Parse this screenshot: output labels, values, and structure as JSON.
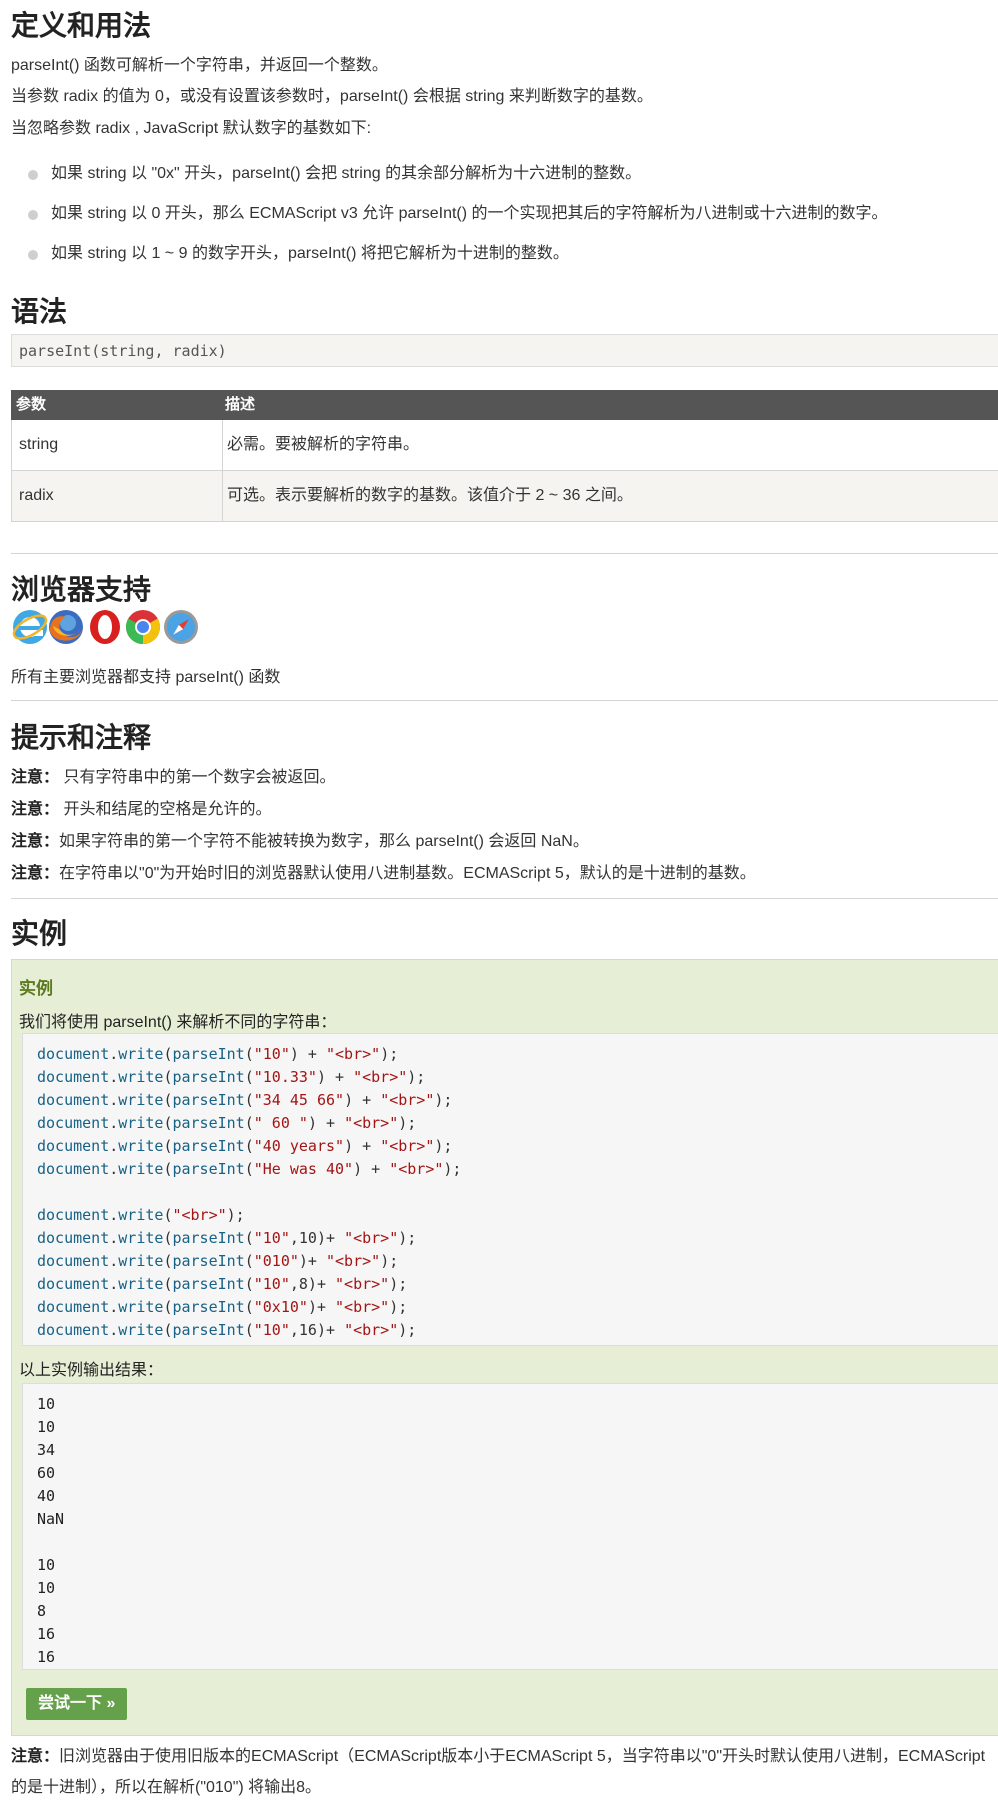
{
  "definition": {
    "heading": "定义和用法",
    "paragraphs": [
      "parseInt() 函数可解析一个字符串，并返回一个整数。",
      "当参数 radix 的值为 0，或没有设置该参数时，parseInt() 会根据 string 来判断数字的基数。",
      "当忽略参数 radix , JavaScript 默认数字的基数如下:"
    ],
    "bullets": [
      "如果 string 以 \"0x\" 开头，parseInt() 会把 string 的其余部分解析为十六进制的整数。",
      "如果 string 以 0 开头，那么 ECMAScript v3 允许 parseInt() 的一个实现把其后的字符解析为八进制或十六进制的数字。",
      "如果 string 以 1 ~ 9 的数字开头，parseInt() 将把它解析为十进制的整数。"
    ]
  },
  "syntax": {
    "heading": "语法",
    "code": "parseInt(string, radix)"
  },
  "params_table": {
    "headers": [
      "参数",
      "描述"
    ],
    "rows": [
      [
        "string",
        "必需。要被解析的字符串。"
      ],
      [
        "radix",
        "可选。表示要解析的数字的基数。该值介于 2 ~ 36 之间。"
      ]
    ]
  },
  "browser_support": {
    "heading": "浏览器支持",
    "icons": [
      "ie-icon",
      "firefox-icon",
      "opera-icon",
      "chrome-icon",
      "safari-icon"
    ],
    "text": "所有主要浏览器都支持 parseInt() 函数"
  },
  "tips": {
    "heading": "提示和注释",
    "notes": [
      {
        "label": "注意：",
        "text": " 只有字符串中的第一个数字会被返回。"
      },
      {
        "label": "注意：",
        "text": " 开头和结尾的空格是允许的。"
      },
      {
        "label": "注意：",
        "text": "如果字符串的第一个字符不能被转换为数字，那么 parseInt() 会返回 NaN。"
      },
      {
        "label": "注意：",
        "text": "在字符串以\"0\"为开始时旧的浏览器默认使用八进制基数。ECMAScript 5，默认的是十进制的基数。"
      }
    ]
  },
  "example": {
    "heading": "实例",
    "box_title": "实例",
    "description": "我们将使用 parseInt() 来解析不同的字符串：",
    "code_lines": [
      [
        {
          "t": "document",
          "c": "fn"
        },
        {
          "t": ".",
          "c": "pl"
        },
        {
          "t": "write",
          "c": "fn"
        },
        {
          "t": "(",
          "c": "pl"
        },
        {
          "t": "parseInt",
          "c": "fn"
        },
        {
          "t": "(",
          "c": "pl"
        },
        {
          "t": "\"10\"",
          "c": "st"
        },
        {
          "t": ") + ",
          "c": "pl"
        },
        {
          "t": "\"<br>\"",
          "c": "st"
        },
        {
          "t": ");",
          "c": "pl"
        }
      ],
      [
        {
          "t": "document",
          "c": "fn"
        },
        {
          "t": ".",
          "c": "pl"
        },
        {
          "t": "write",
          "c": "fn"
        },
        {
          "t": "(",
          "c": "pl"
        },
        {
          "t": "parseInt",
          "c": "fn"
        },
        {
          "t": "(",
          "c": "pl"
        },
        {
          "t": "\"10.33\"",
          "c": "st"
        },
        {
          "t": ") + ",
          "c": "pl"
        },
        {
          "t": "\"<br>\"",
          "c": "st"
        },
        {
          "t": ");",
          "c": "pl"
        }
      ],
      [
        {
          "t": "document",
          "c": "fn"
        },
        {
          "t": ".",
          "c": "pl"
        },
        {
          "t": "write",
          "c": "fn"
        },
        {
          "t": "(",
          "c": "pl"
        },
        {
          "t": "parseInt",
          "c": "fn"
        },
        {
          "t": "(",
          "c": "pl"
        },
        {
          "t": "\"34 45 66\"",
          "c": "st"
        },
        {
          "t": ") + ",
          "c": "pl"
        },
        {
          "t": "\"<br>\"",
          "c": "st"
        },
        {
          "t": ");",
          "c": "pl"
        }
      ],
      [
        {
          "t": "document",
          "c": "fn"
        },
        {
          "t": ".",
          "c": "pl"
        },
        {
          "t": "write",
          "c": "fn"
        },
        {
          "t": "(",
          "c": "pl"
        },
        {
          "t": "parseInt",
          "c": "fn"
        },
        {
          "t": "(",
          "c": "pl"
        },
        {
          "t": "\" 60 \"",
          "c": "st"
        },
        {
          "t": ") + ",
          "c": "pl"
        },
        {
          "t": "\"<br>\"",
          "c": "st"
        },
        {
          "t": ");",
          "c": "pl"
        }
      ],
      [
        {
          "t": "document",
          "c": "fn"
        },
        {
          "t": ".",
          "c": "pl"
        },
        {
          "t": "write",
          "c": "fn"
        },
        {
          "t": "(",
          "c": "pl"
        },
        {
          "t": "parseInt",
          "c": "fn"
        },
        {
          "t": "(",
          "c": "pl"
        },
        {
          "t": "\"40 years\"",
          "c": "st"
        },
        {
          "t": ") + ",
          "c": "pl"
        },
        {
          "t": "\"<br>\"",
          "c": "st"
        },
        {
          "t": ");",
          "c": "pl"
        }
      ],
      [
        {
          "t": "document",
          "c": "fn"
        },
        {
          "t": ".",
          "c": "pl"
        },
        {
          "t": "write",
          "c": "fn"
        },
        {
          "t": "(",
          "c": "pl"
        },
        {
          "t": "parseInt",
          "c": "fn"
        },
        {
          "t": "(",
          "c": "pl"
        },
        {
          "t": "\"He was 40\"",
          "c": "st"
        },
        {
          "t": ") + ",
          "c": "pl"
        },
        {
          "t": "\"<br>\"",
          "c": "st"
        },
        {
          "t": ");",
          "c": "pl"
        }
      ],
      [],
      [
        {
          "t": "document",
          "c": "fn"
        },
        {
          "t": ".",
          "c": "pl"
        },
        {
          "t": "write",
          "c": "fn"
        },
        {
          "t": "(",
          "c": "pl"
        },
        {
          "t": "\"<br>\"",
          "c": "st"
        },
        {
          "t": ");",
          "c": "pl"
        }
      ],
      [
        {
          "t": "document",
          "c": "fn"
        },
        {
          "t": ".",
          "c": "pl"
        },
        {
          "t": "write",
          "c": "fn"
        },
        {
          "t": "(",
          "c": "pl"
        },
        {
          "t": "parseInt",
          "c": "fn"
        },
        {
          "t": "(",
          "c": "pl"
        },
        {
          "t": "\"10\"",
          "c": "st"
        },
        {
          "t": ",10)+ ",
          "c": "pl"
        },
        {
          "t": "\"<br>\"",
          "c": "st"
        },
        {
          "t": ");",
          "c": "pl"
        }
      ],
      [
        {
          "t": "document",
          "c": "fn"
        },
        {
          "t": ".",
          "c": "pl"
        },
        {
          "t": "write",
          "c": "fn"
        },
        {
          "t": "(",
          "c": "pl"
        },
        {
          "t": "parseInt",
          "c": "fn"
        },
        {
          "t": "(",
          "c": "pl"
        },
        {
          "t": "\"010\"",
          "c": "st"
        },
        {
          "t": ")+ ",
          "c": "pl"
        },
        {
          "t": "\"<br>\"",
          "c": "st"
        },
        {
          "t": ");",
          "c": "pl"
        }
      ],
      [
        {
          "t": "document",
          "c": "fn"
        },
        {
          "t": ".",
          "c": "pl"
        },
        {
          "t": "write",
          "c": "fn"
        },
        {
          "t": "(",
          "c": "pl"
        },
        {
          "t": "parseInt",
          "c": "fn"
        },
        {
          "t": "(",
          "c": "pl"
        },
        {
          "t": "\"10\"",
          "c": "st"
        },
        {
          "t": ",8)+ ",
          "c": "pl"
        },
        {
          "t": "\"<br>\"",
          "c": "st"
        },
        {
          "t": ");",
          "c": "pl"
        }
      ],
      [
        {
          "t": "document",
          "c": "fn"
        },
        {
          "t": ".",
          "c": "pl"
        },
        {
          "t": "write",
          "c": "fn"
        },
        {
          "t": "(",
          "c": "pl"
        },
        {
          "t": "parseInt",
          "c": "fn"
        },
        {
          "t": "(",
          "c": "pl"
        },
        {
          "t": "\"0x10\"",
          "c": "st"
        },
        {
          "t": ")+ ",
          "c": "pl"
        },
        {
          "t": "\"<br>\"",
          "c": "st"
        },
        {
          "t": ");",
          "c": "pl"
        }
      ],
      [
        {
          "t": "document",
          "c": "fn"
        },
        {
          "t": ".",
          "c": "pl"
        },
        {
          "t": "write",
          "c": "fn"
        },
        {
          "t": "(",
          "c": "pl"
        },
        {
          "t": "parseInt",
          "c": "fn"
        },
        {
          "t": "(",
          "c": "pl"
        },
        {
          "t": "\"10\"",
          "c": "st"
        },
        {
          "t": ",16)+ ",
          "c": "pl"
        },
        {
          "t": "\"<br>\"",
          "c": "st"
        },
        {
          "t": ");",
          "c": "pl"
        }
      ]
    ],
    "output_label": "以上实例输出结果：",
    "output_lines": [
      "10",
      "10",
      "34",
      "60",
      "40",
      "NaN",
      "",
      "10",
      "10",
      "8",
      "16",
      "16"
    ],
    "try_button": "尝试一下 »"
  },
  "final_note": {
    "label": "注意：",
    "line1": "旧浏览器由于使用旧版本的ECMAScript（ECMAScript版本小于ECMAScript 5，当字符串以\"0\"开头时默认使用八进制，ECMAScript",
    "line2": "的是十进制），所以在解析(\"010\") 将输出8。"
  },
  "colors": {
    "code_function": "#176286",
    "code_string": "#a31515",
    "example_bg": "#e6efd6",
    "button_bg": "#64a14a",
    "table_header_bg": "#555555"
  }
}
